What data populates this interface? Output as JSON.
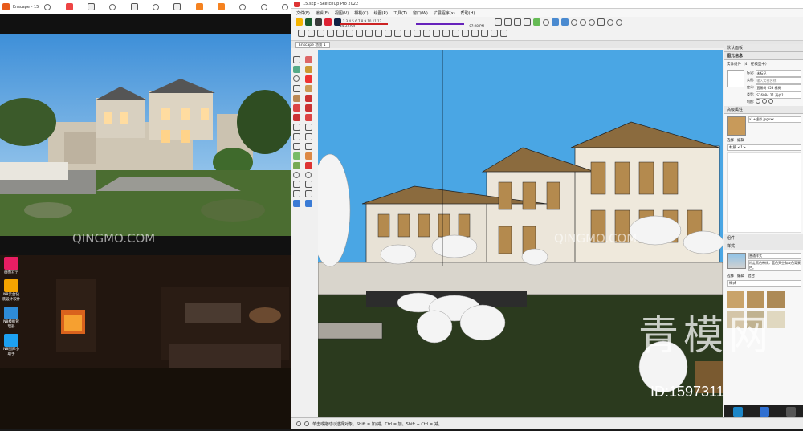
{
  "enscape": {
    "title": "Enscape - 15",
    "preview_bg": "#6fb2e6"
  },
  "desktop": {
    "icons": [
      {
        "label": "画图云学",
        "color": "#e91e63"
      },
      {
        "label": "N8云台快装设计软件",
        "color": "#f4a300"
      },
      {
        "label": "N8模板管理器",
        "color": "#2e8bd8"
      },
      {
        "label": "N8图库小助手",
        "color": "#1da1f2"
      }
    ]
  },
  "sketchup": {
    "title": "15.skp - SketchUp Pro 2022",
    "menu": [
      "文件(F)",
      "编辑(E)",
      "视图(V)",
      "相机(C)",
      "绘图(R)",
      "工具(T)",
      "窗口(W)",
      "扩展程序(x)",
      "帮助(H)"
    ],
    "shadow_time_left": "04:37 AM",
    "shadow_time_right": "07:28 PM",
    "months": "1 2 3 4 5 6 7 8 9 10 11 12",
    "scene_tab": "Enscape 场景 1",
    "status_text": "单击或拖动以选择对象。Shift = 加/减。Ctrl = 加。Shift + Ctrl = 减。"
  },
  "tray": {
    "title": "默认面板",
    "entity_info": {
      "header": "图元信息",
      "subtitle": "实体组件（4，在模型中）",
      "label_tag": "标记:",
      "tag_value": "未标记",
      "label_instance": "实例:",
      "instance_value": "输入实例名称",
      "label_definition": "定义:",
      "definition_value": "置景树 053 模树",
      "label_type": "类型:",
      "type_value": "S16084.21 高价?",
      "label_toggles": "切换:"
    },
    "materials": {
      "header": "高级属性",
      "current": "x1+虚拟 jpgxxx",
      "tab_select": "选择",
      "tab_edit": "编辑",
      "dropdown": "材质 <1>"
    },
    "components": {
      "header": "组件"
    },
    "styles": {
      "header": "样式",
      "style_name": "普通样式",
      "style_desc": "特定黑色带线，蓝色天空和灰色背景色。",
      "tab_select": "选择",
      "tab_edit": "编辑",
      "tab_mix": "混合",
      "dropdown": "样式"
    }
  },
  "watermark": {
    "site": "QINGMO.COM",
    "brand": "青模网",
    "id_text": "ID:1597311"
  }
}
